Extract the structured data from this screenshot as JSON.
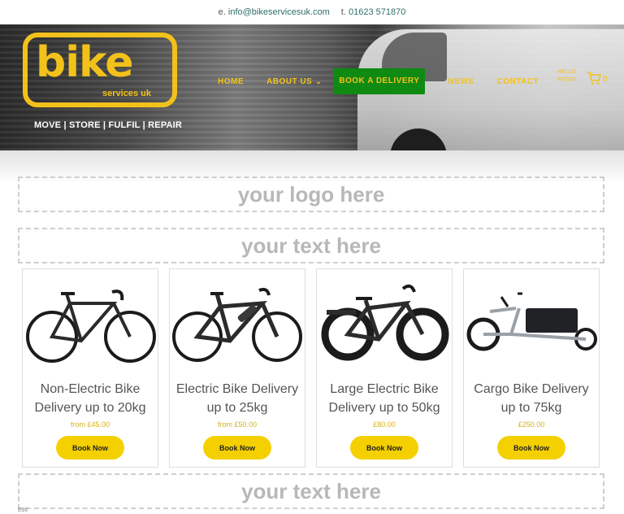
{
  "topbar": {
    "email_prefix": "e.",
    "email": "info@bikeservicesuk.com",
    "phone_prefix": "t.",
    "phone": "01623 571870"
  },
  "logo": {
    "word": "bike",
    "sub": "services uk",
    "tagline": "MOVE | STORE | FULFIL | REPAIR"
  },
  "nav": {
    "home": "HOME",
    "about": "ABOUT US",
    "book": "BOOK A DELIVERY",
    "news": "NEWS",
    "contact": "CONTACT",
    "hello_line1": "HELLO",
    "hello_line2": "PETER",
    "cart_count": "0"
  },
  "placeholders": {
    "logo": "your logo here",
    "text1": "your text here",
    "text2": "your text here"
  },
  "products": [
    {
      "title": "Non-Electric Bike Delivery up to 20kg",
      "price": "from £45.00",
      "button": "Book Now",
      "icon": "road-bike-icon"
    },
    {
      "title": "Electric Bike Delivery up to 25kg",
      "price": "from £50.00",
      "button": "Book Now",
      "icon": "ebike-icon"
    },
    {
      "title": "Large Electric Bike Delivery up to 50kg",
      "price": "£80.00",
      "button": "Book Now",
      "icon": "fat-ebike-icon"
    },
    {
      "title": "Cargo Bike Delivery up to 75kg",
      "price": "£250.00",
      "button": "Book Now",
      "icon": "cargo-bike-icon"
    }
  ],
  "footer": {
    "edit": "Edit"
  },
  "colors": {
    "brand_yellow": "#f2c21b",
    "cta_green": "#0f8a12",
    "button_yellow": "#f5d000"
  }
}
